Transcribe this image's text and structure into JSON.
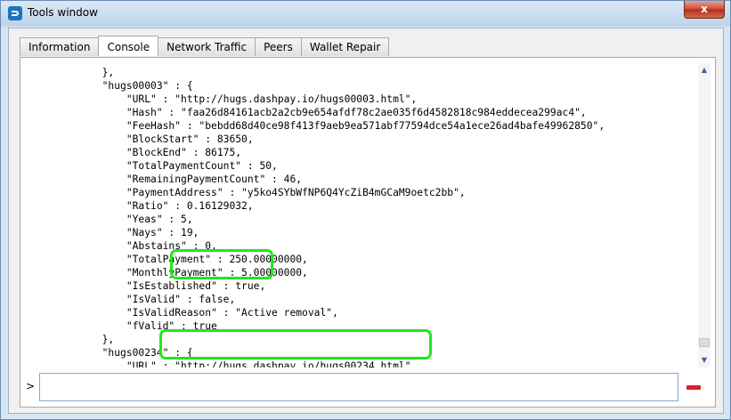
{
  "window": {
    "title": "Tools window",
    "close_label": "x"
  },
  "tabs": [
    {
      "label": "Information",
      "active": false
    },
    {
      "label": "Console",
      "active": true
    },
    {
      "label": "Network Traffic",
      "active": false
    },
    {
      "label": "Peers",
      "active": false
    },
    {
      "label": "Wallet Repair",
      "active": false
    }
  ],
  "console": {
    "lines": [
      "                \"fValid\" : true",
      "            },",
      "            \"hugs00003\" : {",
      "                \"URL\" : \"http://hugs.dashpay.io/hugs00003.html\",",
      "                \"Hash\" : \"faa26d84161acb2a2cb9e654afdf78c2ae035f6d4582818c984eddecea299ac4\",",
      "                \"FeeHash\" : \"bebdd68d40ce98f413f9aeb9ea571abf77594dce54a1ece26ad4bafe49962850\",",
      "                \"BlockStart\" : 83650,",
      "                \"BlockEnd\" : 86175,",
      "                \"TotalPaymentCount\" : 50,",
      "                \"RemainingPaymentCount\" : 46,",
      "                \"PaymentAddress\" : \"y5ko4SYbWfNP6Q4YcZiB4mGCaM9oetc2bb\",",
      "                \"Ratio\" : 0.16129032,",
      "                \"Yeas\" : 5,",
      "                \"Nays\" : 19,",
      "                \"Abstains\" : 0,",
      "                \"TotalPayment\" : 250.00000000,",
      "                \"MonthlyPayment\" : 5.00000000,",
      "                \"IsEstablished\" : true,",
      "                \"IsValid\" : false,",
      "                \"IsValidReason\" : \"Active removal\",",
      "                \"fValid\" : true",
      "            },",
      "            \"hugs00234\" : {",
      "                \"URL\" : \"http://hugs.dashpay.io/hugs00234.html\","
    ]
  },
  "input": {
    "prompt": ">",
    "value": ""
  },
  "scrollbar": {
    "up_arrow": "▲",
    "down_arrow": "▼"
  },
  "colors": {
    "highlight": "#22e81c",
    "clear_button": "#d8202a"
  }
}
